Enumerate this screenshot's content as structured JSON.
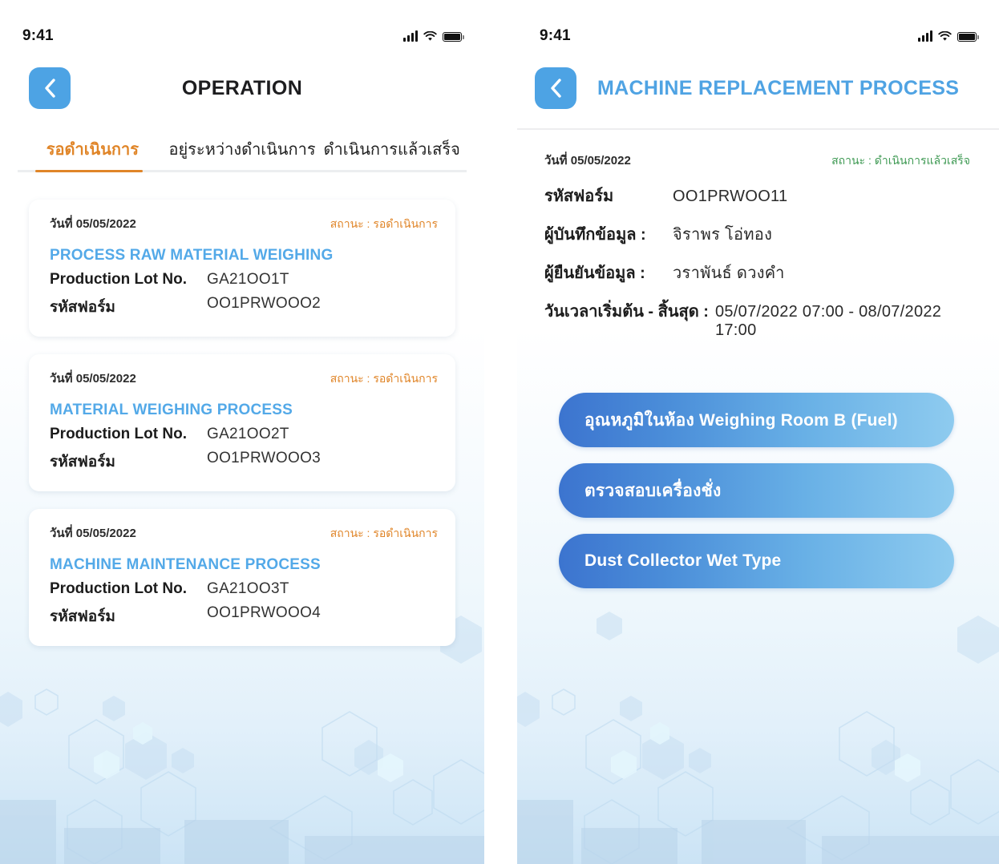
{
  "left_screen": {
    "status_bar": {
      "time": "9:41",
      "signal_icon": "signal-bars-icon",
      "wifi_icon": "wifi-icon",
      "battery_icon": "battery-icon"
    },
    "nav": {
      "back_icon": "chevron-left-icon",
      "title": "OPERATION"
    },
    "tabs": [
      {
        "label": "รอดำเนินการ",
        "active": true
      },
      {
        "label": "อยู่ระหว่างดำเนินการ",
        "active": false
      },
      {
        "label": "ดำเนินการแล้วเสร็จ",
        "active": false
      }
    ],
    "cards": [
      {
        "date": "วันที่ 05/05/2022",
        "status": "สถานะ : รอดำเนินการ",
        "title": "PROCESS RAW MATERIAL WEIGHING",
        "lot_label": "Production Lot No.",
        "lot_value": "GA21OO1T",
        "form_label": "รหัสฟอร์ม",
        "form_value": "OO1PRWOOO2"
      },
      {
        "date": "วันที่ 05/05/2022",
        "status": "สถานะ : รอดำเนินการ",
        "title": "MATERIAL WEIGHING PROCESS",
        "lot_label": "Production Lot No.",
        "lot_value": "GA21OO2T",
        "form_label": "รหัสฟอร์ม",
        "form_value": "OO1PRWOOO3"
      },
      {
        "date": "วันที่ 05/05/2022",
        "status": "สถานะ : รอดำเนินการ",
        "title": "MACHINE MAINTENANCE PROCESS",
        "lot_label": "Production Lot No.",
        "lot_value": "GA21OO3T",
        "form_label": "รหัสฟอร์ม",
        "form_value": "OO1PRWOOO4"
      }
    ]
  },
  "right_screen": {
    "status_bar": {
      "time": "9:41",
      "signal_icon": "signal-bars-icon",
      "wifi_icon": "wifi-icon",
      "battery_icon": "battery-icon"
    },
    "nav": {
      "back_icon": "chevron-left-icon",
      "title": "MACHINE REPLACEMENT PROCESS"
    },
    "detail": {
      "date": "วันที่ 05/05/2022",
      "status": "สถานะ : ดำเนินการแล้วเสร็จ",
      "rows": [
        {
          "label": "รหัสฟอร์ม",
          "value": "OO1PRWOO11"
        },
        {
          "label": "ผู้บันทึกข้อมูล :",
          "value": "จิราพร โอ่ทอง"
        },
        {
          "label": "ผู้ยืนยันข้อมูล :",
          "value": "วราพันธ์ ดวงคำ"
        }
      ],
      "period_label": "วันเวลาเริ่มต้น - สิ้นสุด :",
      "period_value": "05/07/2022 07:00 -  08/07/2022 17:00"
    },
    "actions": [
      {
        "label": "อุณหภูมิในห้อง Weighing Room B (Fuel)"
      },
      {
        "label": "ตรวจสอบเครื่องชั่ง"
      },
      {
        "label": "Dust Collector Wet Type"
      }
    ]
  },
  "colors": {
    "accent_blue": "#4da3e4",
    "title_blue": "#53a9e8",
    "status_orange": "#e08528",
    "status_green": "#3f9a54",
    "button_gradient_start": "#3c74cf",
    "button_gradient_end": "#8ecbef",
    "background_bottom": "#cbe3f5"
  }
}
